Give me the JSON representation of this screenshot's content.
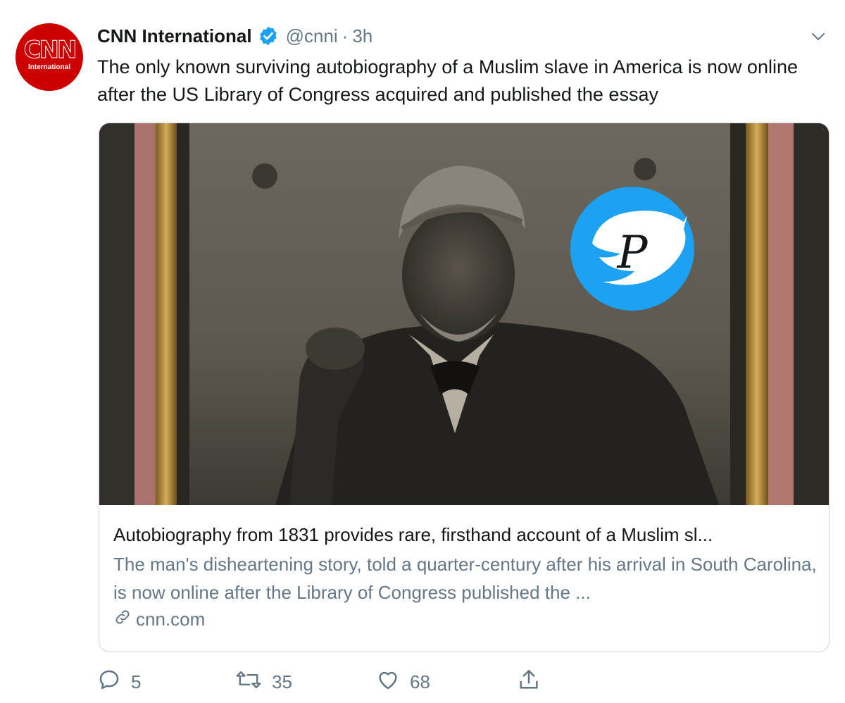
{
  "tweet": {
    "avatar": {
      "logo": "CNN",
      "subtitle": "International"
    },
    "author_name": "CNN International",
    "handle": "@cnni",
    "separator": "·",
    "time": "3h",
    "text": "The only known surviving autobiography of a Muslim slave in America is now online after the US Library of Congress acquired and published the essay",
    "colors": {
      "accent": "#1da1f2",
      "brand": "#cc0000",
      "muted": "#657786"
    }
  },
  "card": {
    "title": "Autobiography from 1831 provides rare, firsthand account of a Muslim sl...",
    "description": "The man's disheartening story, told a quarter-century after his arrival in South Carolina, is now online after the Library of Congress published the ...",
    "domain": "cnn.com",
    "watermark_letter": "P"
  },
  "actions": {
    "reply_count": "5",
    "retweet_count": "35",
    "like_count": "68",
    "icons": [
      "reply-icon",
      "retweet-icon",
      "like-icon",
      "share-icon"
    ]
  }
}
